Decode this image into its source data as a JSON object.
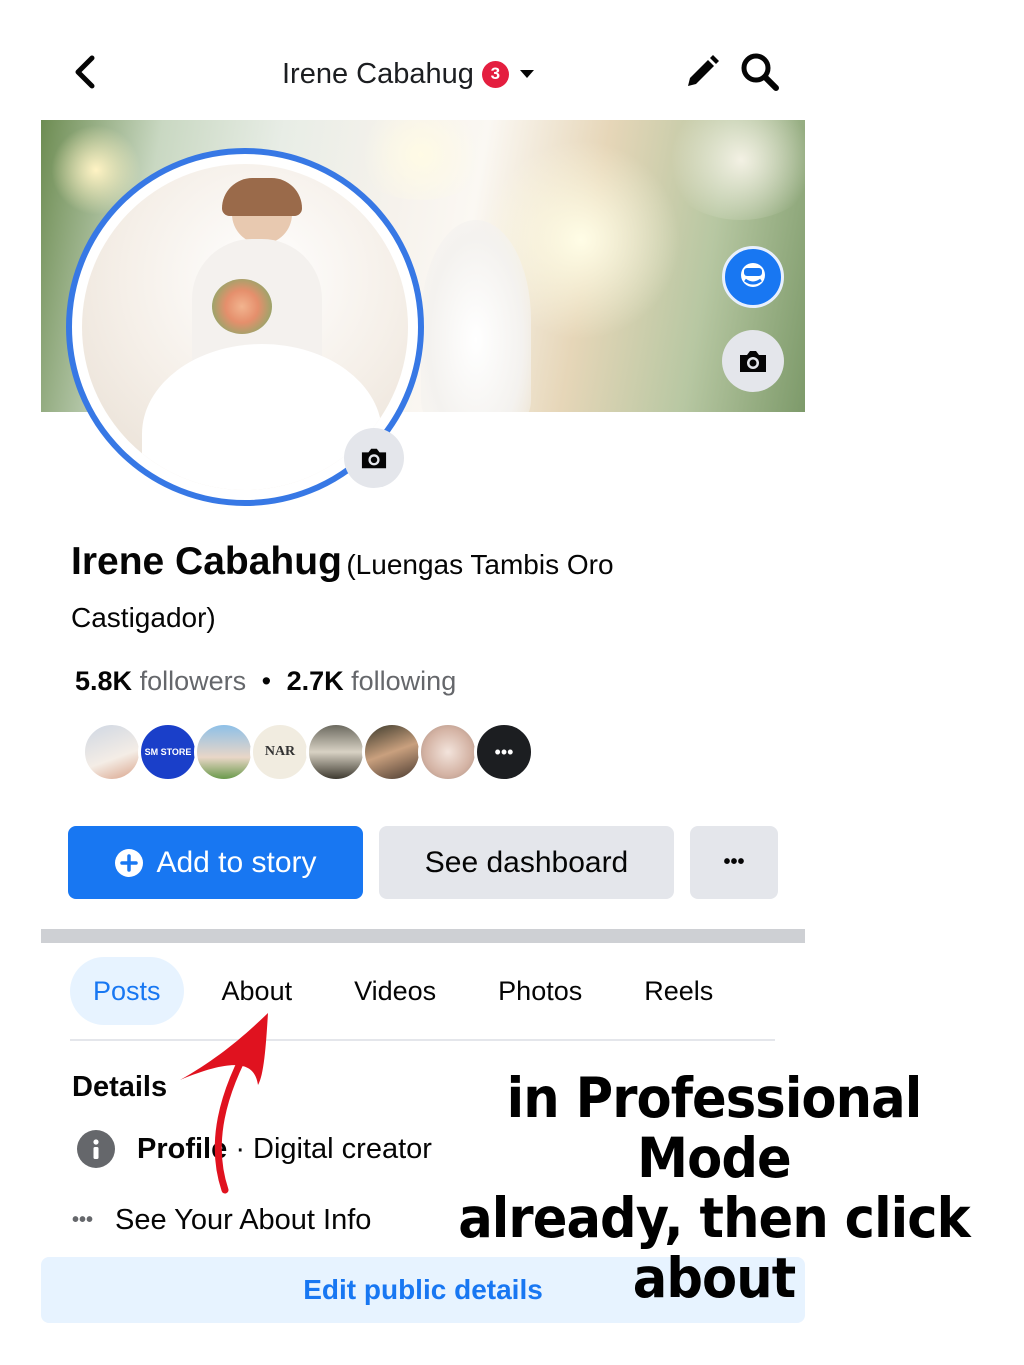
{
  "header": {
    "title": "Irene Cabahug",
    "notification_count": "3"
  },
  "profile": {
    "name": "Irene Cabahug",
    "alternate_name": "(Luengas Tambis Oro Castigador)",
    "followers_count": "5.8K",
    "followers_label": "followers",
    "separator": "•",
    "following_count": "2.7K",
    "following_label": "following"
  },
  "friends": [
    {
      "label": ""
    },
    {
      "label": "SM STORE"
    },
    {
      "label": ""
    },
    {
      "label": "NAR"
    },
    {
      "label": ""
    },
    {
      "label": ""
    },
    {
      "label": ""
    },
    {
      "label": "•••"
    }
  ],
  "actions": {
    "add_story": "Add to story",
    "dashboard": "See dashboard",
    "more": "•••"
  },
  "tabs": [
    "Posts",
    "About",
    "Videos",
    "Photos",
    "Reels"
  ],
  "details": {
    "heading": "Details",
    "profile_type_label": "Profile",
    "profile_type_value": "· Digital creator",
    "about_info": "See Your About Info",
    "about_info_icon": "•••",
    "edit_button": "Edit public details"
  },
  "annotation": {
    "line1": "in Professional Mode",
    "line2": "already, then click",
    "line3": "about"
  },
  "colors": {
    "brand_blue": "#1877f2",
    "notification_red": "#e41e3f",
    "annotation_arrow": "#e0121f"
  }
}
